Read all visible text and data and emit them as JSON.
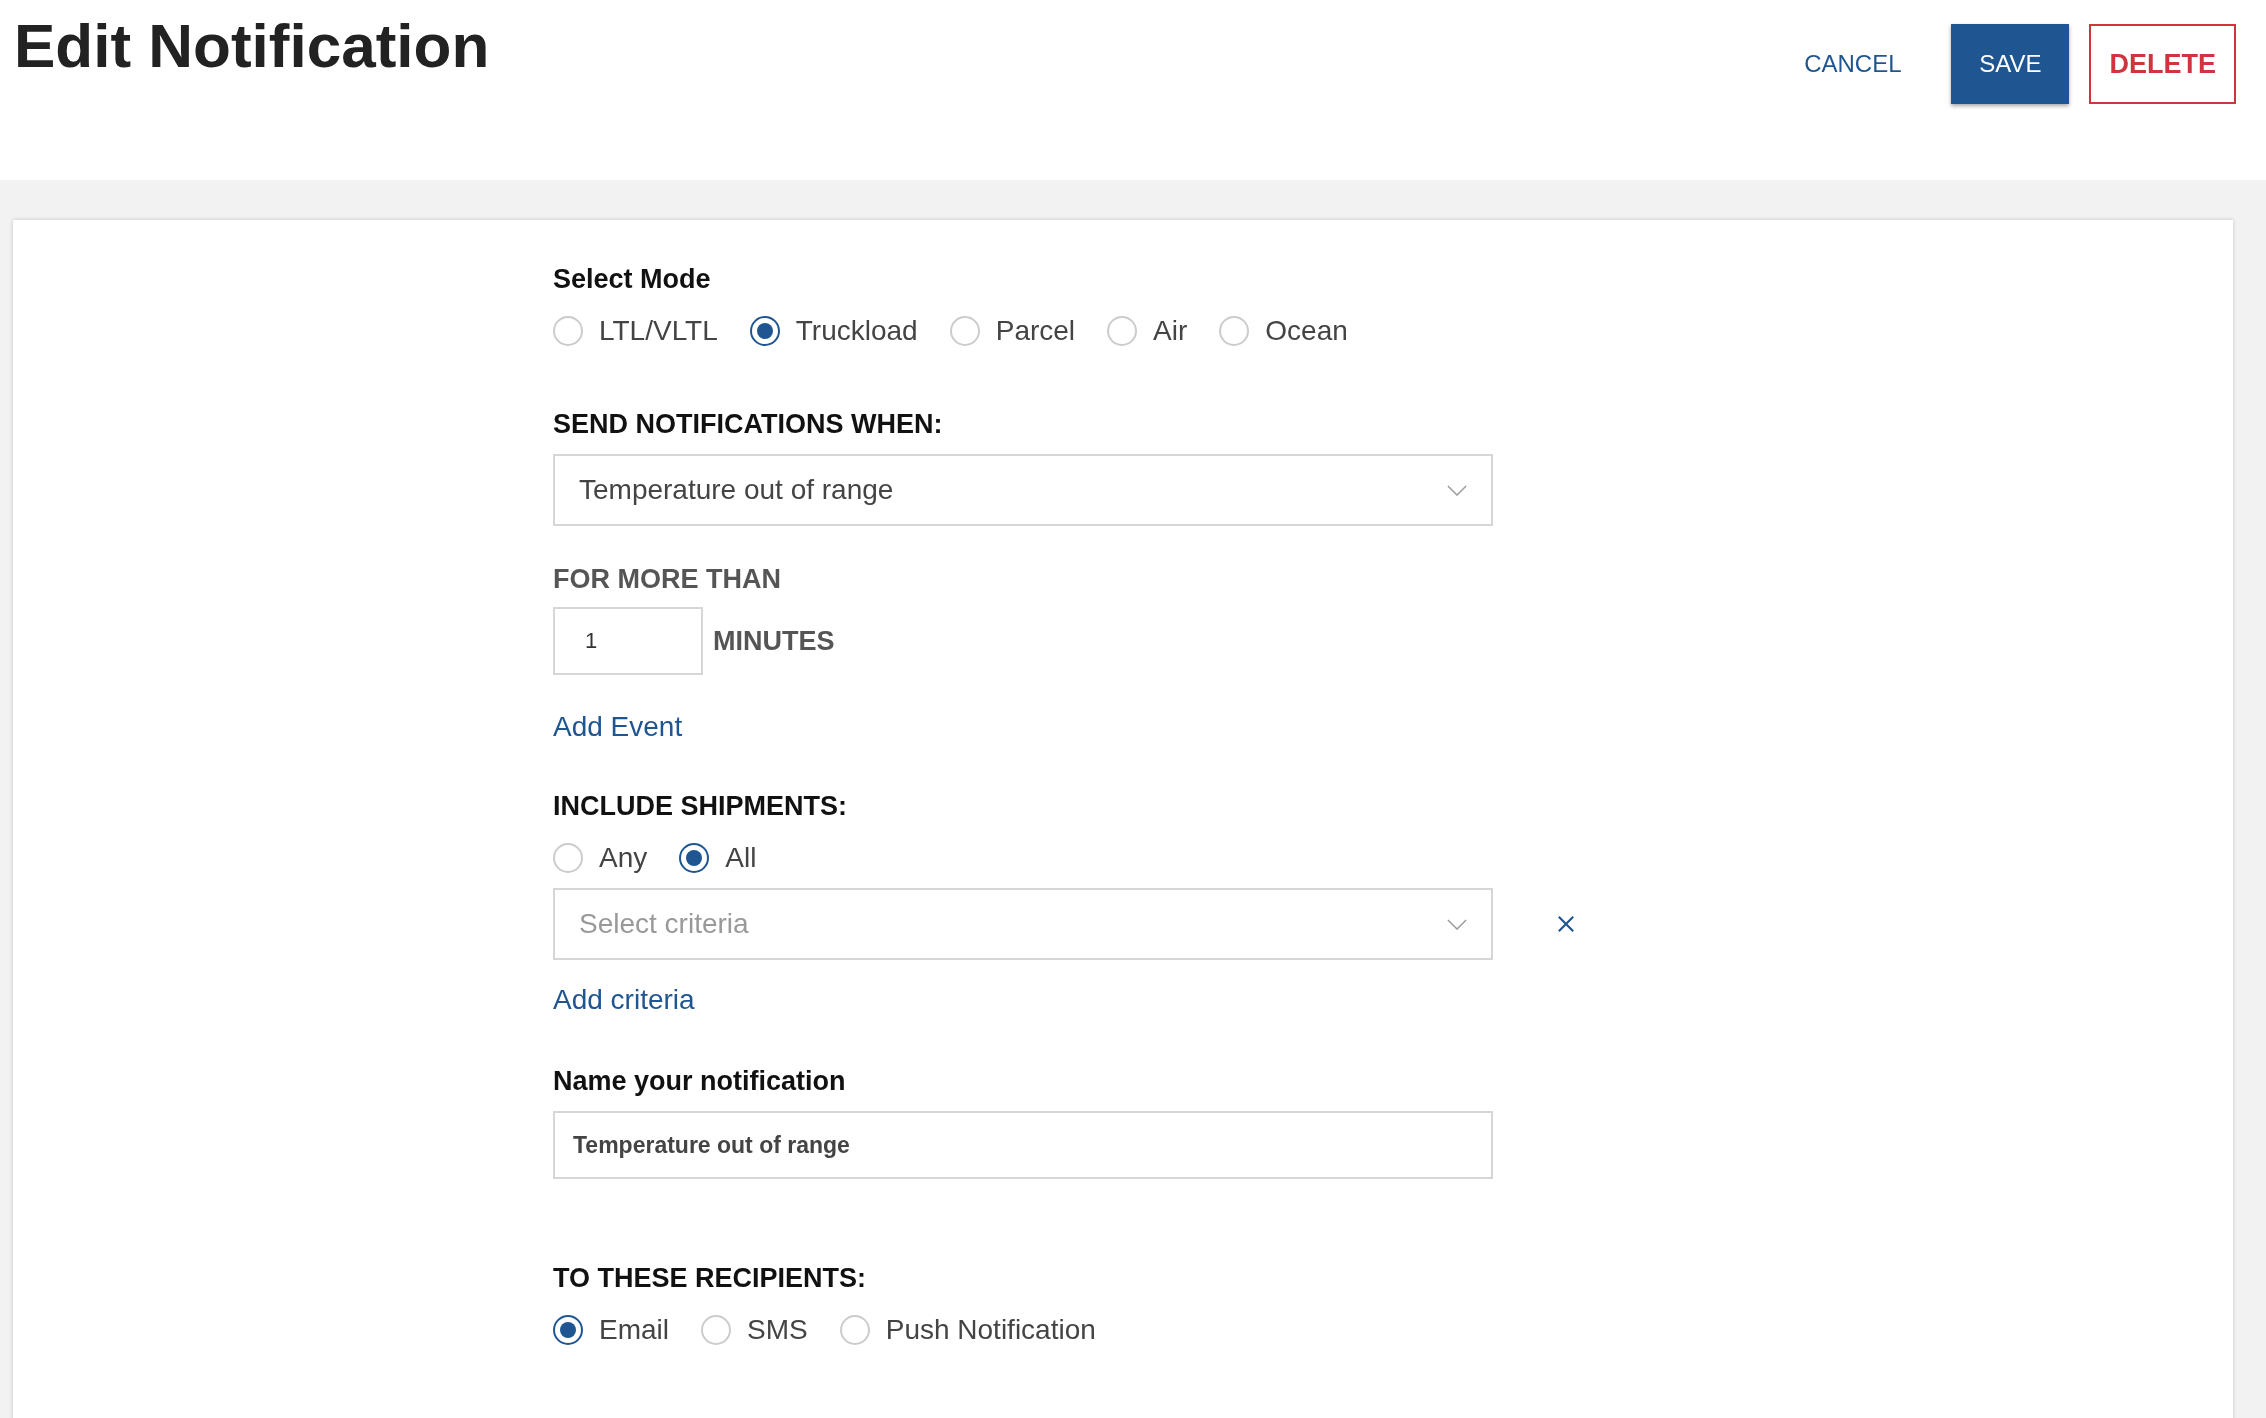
{
  "header": {
    "title": "Edit Notification",
    "buttons": [
      {
        "kind": "text",
        "label": "CANCEL"
      },
      {
        "kind": "primary",
        "label": "SAVE"
      },
      {
        "kind": "danger",
        "label": "DELETE"
      }
    ]
  },
  "mode": {
    "label": "Select Mode",
    "options": [
      {
        "label": "LTL/VLTL",
        "selected": false
      },
      {
        "label": "Truckload",
        "selected": true
      },
      {
        "label": "Parcel",
        "selected": false
      },
      {
        "label": "Air",
        "selected": false
      },
      {
        "label": "Ocean",
        "selected": false
      }
    ]
  },
  "send_when": {
    "label": "SEND NOTIFICATIONS WHEN:",
    "value": "Temperature out of range"
  },
  "duration": {
    "label": "FOR MORE THAN",
    "value": "1",
    "unit": "MINUTES"
  },
  "add_event": "Add Event",
  "include": {
    "label": "INCLUDE SHIPMENTS:",
    "options": [
      {
        "label": "Any",
        "selected": false
      },
      {
        "label": "All",
        "selected": true
      }
    ],
    "criteria_placeholder": "Select criteria",
    "add_criteria": "Add criteria"
  },
  "name": {
    "label": "Name your notification",
    "value": "Temperature out of range"
  },
  "recipients": {
    "label": "TO THESE RECIPIENTS:",
    "options": [
      {
        "label": "Email",
        "selected": true
      },
      {
        "label": "SMS",
        "selected": false
      },
      {
        "label": "Push Notification",
        "selected": false
      }
    ]
  }
}
